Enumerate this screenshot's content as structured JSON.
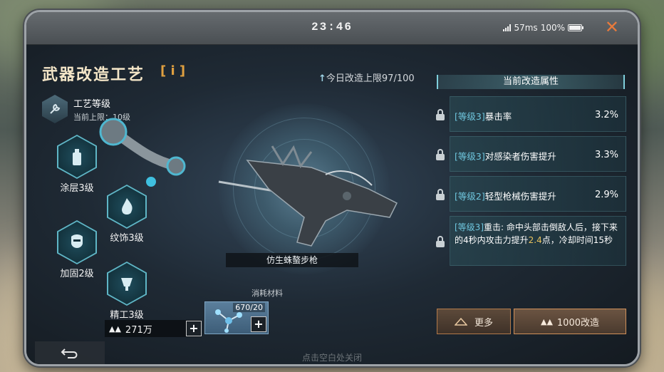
{
  "status": {
    "time": "23:46",
    "ping": "57ms",
    "battery": "100%"
  },
  "header": {
    "title": "武器改造工艺",
    "info_label": "[ i ]",
    "daily_limit": "今日改造上限97/100"
  },
  "craft": {
    "name": "工艺等级",
    "limit": "当前上限：10级"
  },
  "mods": [
    {
      "label": "涂层3级",
      "icon": "spray-can-icon"
    },
    {
      "label": "纹饰3级",
      "icon": "flame-icon"
    },
    {
      "label": "加固2级",
      "icon": "mask-icon"
    },
    {
      "label": "精工3级",
      "icon": "cup-icon"
    }
  ],
  "weapon": {
    "name": "仿生蛛螯步枪"
  },
  "materials": {
    "label": "消耗材料",
    "count": "670/20",
    "gold": "271万"
  },
  "attributes": {
    "header": "当前改造属性",
    "rows": [
      {
        "level": "[等级3]",
        "name": "暴击率",
        "value": "3.2%"
      },
      {
        "level": "[等级3]",
        "name": "对感染者伤害提升",
        "value": "3.3%"
      },
      {
        "level": "[等级2]",
        "name": "轻型枪械伤害提升",
        "value": "2.9%"
      }
    ],
    "special": {
      "level": "[等级3]",
      "text_a": "重击: 命中头部击倒敌人后，接下来的4秒内攻击力提升",
      "highlight": "2.4",
      "text_b": "点，冷却时间15秒"
    }
  },
  "buttons": {
    "more": "更多",
    "upgrade": "1000改造"
  },
  "footer": {
    "hint": "点击空白处关闭"
  },
  "colors": {
    "accent": "#7fd0dc",
    "title": "#f4e6c8",
    "level": "#6fc7df",
    "highlight": "#e8c25e"
  }
}
